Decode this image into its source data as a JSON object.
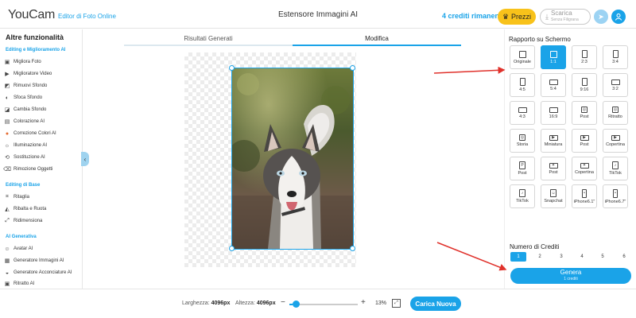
{
  "app": {
    "logo": "YouCam",
    "logo_sub": "Editor di Foto Online",
    "page_title": "Estensore Immagini AI",
    "credits_remaining": "4 crediti rimanenti",
    "prices_label": "Prezzi",
    "download_label": "Scarica",
    "download_sub": "Senza Filigrana"
  },
  "sidebar": {
    "title": "Altre funzionalità",
    "sections": [
      {
        "label": "Editing e Miglioramento AI",
        "items": [
          {
            "label": "Migliora Foto",
            "icon": "photo-enhance-icon"
          },
          {
            "label": "Miglioratore Video",
            "icon": "video-enhance-icon"
          },
          {
            "label": "Rimuovi Sfondo",
            "icon": "remove-bg-icon"
          },
          {
            "label": "Sfoca Sfondo",
            "icon": "blur-bg-icon"
          },
          {
            "label": "Cambia Sfondo",
            "icon": "change-bg-icon"
          },
          {
            "label": "Colorazione AI",
            "icon": "colorize-icon"
          },
          {
            "label": "Correzione Colori AI",
            "icon": "color-correct-icon"
          },
          {
            "label": "Illuminazione AI",
            "icon": "lighting-icon"
          },
          {
            "label": "Sostituzione AI",
            "icon": "replace-icon"
          },
          {
            "label": "Rimozione Oggetti",
            "icon": "object-remove-icon"
          }
        ]
      },
      {
        "label": "Editing di Base",
        "items": [
          {
            "label": "Ritaglia",
            "icon": "crop-icon"
          },
          {
            "label": "Ribalta e Ruota",
            "icon": "flip-rotate-icon"
          },
          {
            "label": "Ridimensiona",
            "icon": "resize-icon"
          }
        ]
      },
      {
        "label": "AI Generativa",
        "items": [
          {
            "label": "Avatar AI",
            "icon": "avatar-ai-icon"
          },
          {
            "label": "Generatore Immagini AI",
            "icon": "image-gen-icon"
          },
          {
            "label": "Generatore Acconciature AI",
            "icon": "hairstyle-icon"
          },
          {
            "label": "Ritratto AI",
            "icon": "portrait-icon"
          }
        ]
      }
    ]
  },
  "tabs": [
    {
      "label": "Risultati Generati",
      "active": false
    },
    {
      "label": "Modifica",
      "active": true
    }
  ],
  "bottom": {
    "width_label": "Larghezza:",
    "width_value": "4096px",
    "height_label": "Altezza:",
    "height_value": "4096px",
    "zoom_minus": "−",
    "zoom_plus": "+",
    "zoom_percent": "13%",
    "zoom_level": 0.13,
    "upload_label": "Carica Nuova"
  },
  "right_panel": {
    "aspect_title": "Rapporto su Schermo",
    "aspect_options": [
      {
        "label": "Originale",
        "icon": "square-icon",
        "selected": false
      },
      {
        "label": "1:1",
        "icon": "square-icon",
        "selected": true
      },
      {
        "label": "2:3",
        "icon": "portrait-rect-icon",
        "selected": false
      },
      {
        "label": "3:4",
        "icon": "portrait-rect-icon",
        "selected": false
      },
      {
        "label": "4:5",
        "icon": "portrait-rect-icon",
        "selected": false
      },
      {
        "label": "5:4",
        "icon": "landscape-rect-icon",
        "selected": false
      },
      {
        "label": "9:16",
        "icon": "portrait-rect-icon",
        "selected": false
      },
      {
        "label": "3:2",
        "icon": "landscape-rect-icon",
        "selected": false
      },
      {
        "label": "4:3",
        "icon": "landscape-rect-icon",
        "selected": false
      },
      {
        "label": "16:9",
        "icon": "landscape-rect-icon",
        "selected": false
      },
      {
        "label": "Post",
        "icon": "instagram-icon",
        "selected": false
      },
      {
        "label": "Ritratto",
        "icon": "instagram-icon",
        "selected": false
      },
      {
        "label": "Storia",
        "icon": "instagram-icon",
        "selected": false
      },
      {
        "label": "Miniatura",
        "icon": "youtube-icon",
        "selected": false
      },
      {
        "label": "Post",
        "icon": "youtube-icon",
        "selected": false
      },
      {
        "label": "Copertina",
        "icon": "youtube-icon",
        "selected": false
      },
      {
        "label": "Post",
        "icon": "pinterest-icon",
        "selected": false
      },
      {
        "label": "Post",
        "icon": "twitter-icon",
        "selected": false
      },
      {
        "label": "Copertina",
        "icon": "twitter-icon",
        "selected": false
      },
      {
        "label": "TikTok",
        "icon": "tiktok-icon",
        "selected": false
      },
      {
        "label": "TikTok",
        "icon": "tiktok-icon",
        "selected": false
      },
      {
        "label": "Snapchat",
        "icon": "snapchat-icon",
        "selected": false
      },
      {
        "label": "iPhone6.1\"",
        "icon": "phone-icon",
        "selected": false
      },
      {
        "label": "iPhone6.7\"",
        "icon": "phone-icon",
        "selected": false
      }
    ],
    "credits_title": "Numero di Crediti",
    "credit_options": [
      "1",
      "2",
      "3",
      "4",
      "5",
      "6"
    ],
    "credit_selected": "1",
    "generate_label": "Genera",
    "generate_sub": "1 crediti"
  },
  "colors": {
    "accent": "#1aa3e8",
    "prices_bg": "#f8c21a",
    "arrow": "#e0312b"
  }
}
